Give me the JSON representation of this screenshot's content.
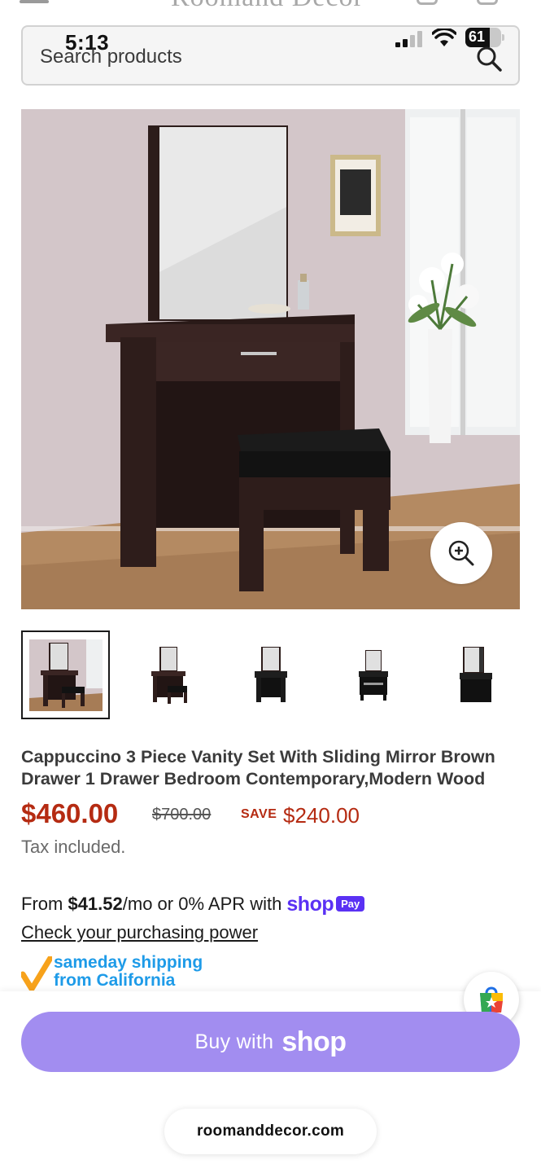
{
  "status_bar": {
    "time": "5:13",
    "battery": "61"
  },
  "header": {
    "brand": "Roomand Decor"
  },
  "search": {
    "placeholder": "Search products"
  },
  "product": {
    "title": "Cappuccino 3 Piece Vanity Set With Sliding Mirror Brown Drawer 1 Drawer Bedroom Contemporary,Modern Wood",
    "price": "$460.00",
    "compare_price": "$700.00",
    "save_label": "SAVE",
    "save_amount": "$240.00",
    "tax_note": "Tax included.",
    "thumbnail_count": 5,
    "active_thumbnail": 1
  },
  "installments": {
    "prefix": "From ",
    "amount": "$41.52",
    "suffix": "/mo or 0% APR with",
    "shop_logo": "shop",
    "pay_badge": "Pay",
    "link": "Check your purchasing power"
  },
  "shipping_badge": {
    "line1": "sameday shipping",
    "line2": "from California"
  },
  "checkout": {
    "buy_text": "Buy with",
    "buy_brand": "shop"
  },
  "footer": {
    "domain": "roomanddecor.com"
  },
  "colors": {
    "price": "#b52b12",
    "shop_purple": "#5a31f4",
    "buy_button": "#a28df0",
    "shipping_blue": "#1e9be8",
    "check_orange": "#f7a21b"
  },
  "icons": [
    "search-icon",
    "zoom-in-icon",
    "shop-app-icon",
    "checkmark-icon",
    "signal-icon",
    "wifi-icon",
    "battery-icon"
  ]
}
